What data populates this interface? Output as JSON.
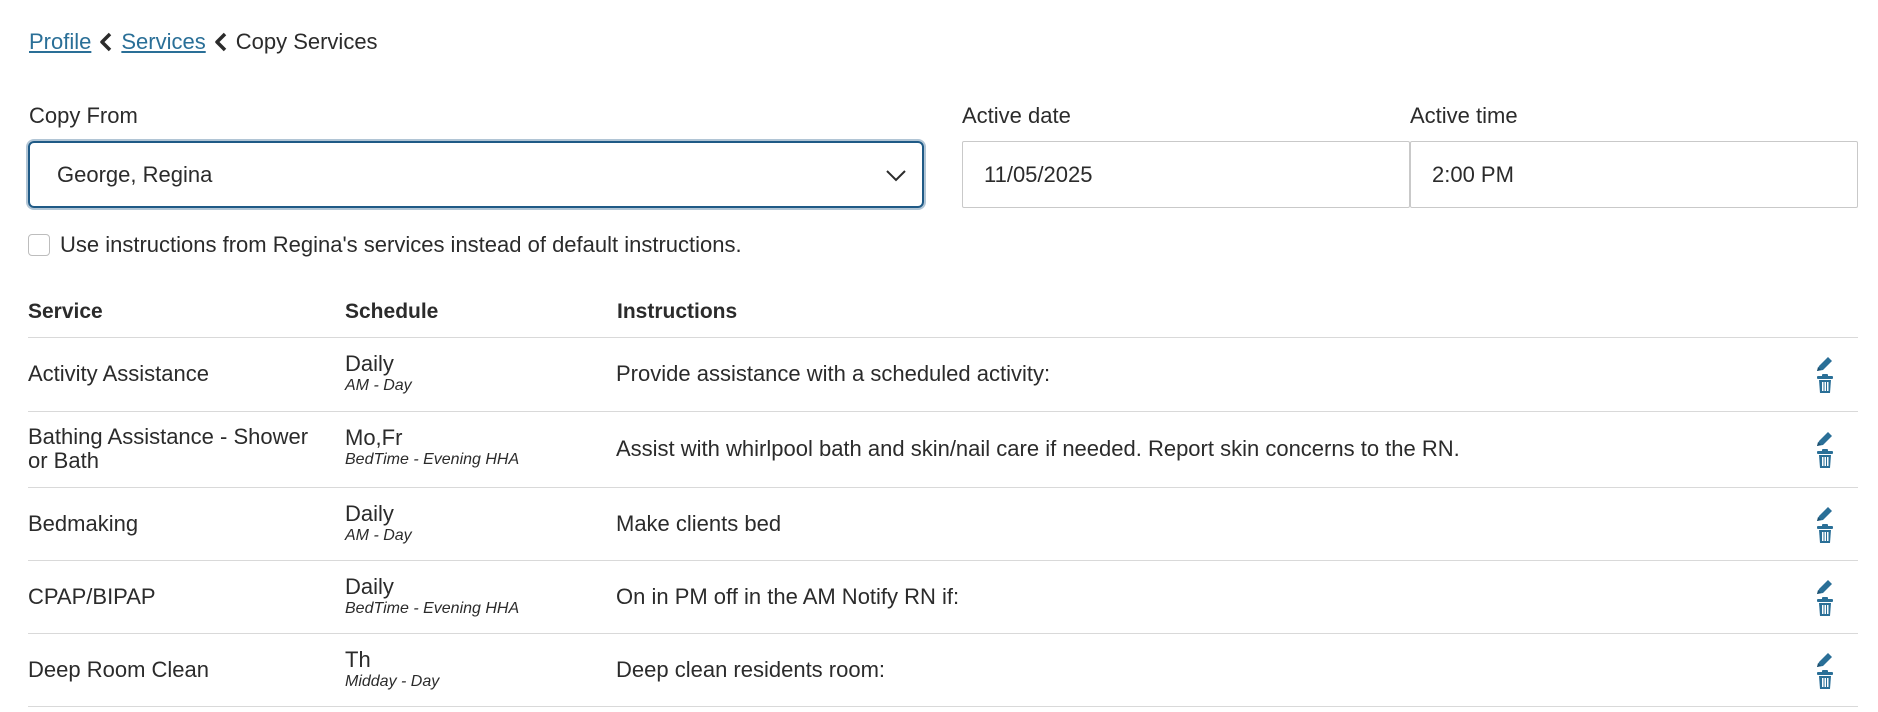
{
  "breadcrumb": {
    "profile": "Profile",
    "services": "Services",
    "current": "Copy Services"
  },
  "form": {
    "copy_from_label": "Copy From",
    "copy_from_value": "George, Regina",
    "active_date_label": "Active date",
    "active_date_value": "11/05/2025",
    "active_time_label": "Active time",
    "active_time_value": "2:00 PM",
    "checkbox_label": "Use instructions from Regina's services instead of default instructions.",
    "checkbox_checked": false
  },
  "table": {
    "headers": {
      "service": "Service",
      "schedule": "Schedule",
      "instructions": "Instructions"
    },
    "rows": [
      {
        "service": "Activity Assistance",
        "schedule": "Daily",
        "shift": "AM - Day",
        "instructions": "Provide assistance with a scheduled activity:"
      },
      {
        "service": "Bathing Assistance - Shower or Bath",
        "schedule": "Mo,Fr",
        "shift": "BedTime - Evening HHA",
        "instructions": "Assist with whirlpool bath and skin/nail care if needed. Report skin concerns to the RN."
      },
      {
        "service": "Bedmaking",
        "schedule": "Daily",
        "shift": "AM - Day",
        "instructions": "Make clients bed"
      },
      {
        "service": "CPAP/BIPAP",
        "schedule": "Daily",
        "shift": "BedTime - Evening HHA",
        "instructions": "On in PM off in the AM Notify RN if:"
      },
      {
        "service": "Deep Room Clean",
        "schedule": "Th",
        "shift": "Midday - Day",
        "instructions": "Deep clean residents room:"
      }
    ]
  },
  "colors": {
    "link": "#2a6f97",
    "focus_border": "#1f5a86",
    "action_icon": "#2a6f97"
  },
  "icons": {
    "breadcrumb_separator": "chevron-left-icon",
    "select_chevron": "chevron-down-icon",
    "edit": "pencil-icon",
    "delete": "trash-icon"
  }
}
